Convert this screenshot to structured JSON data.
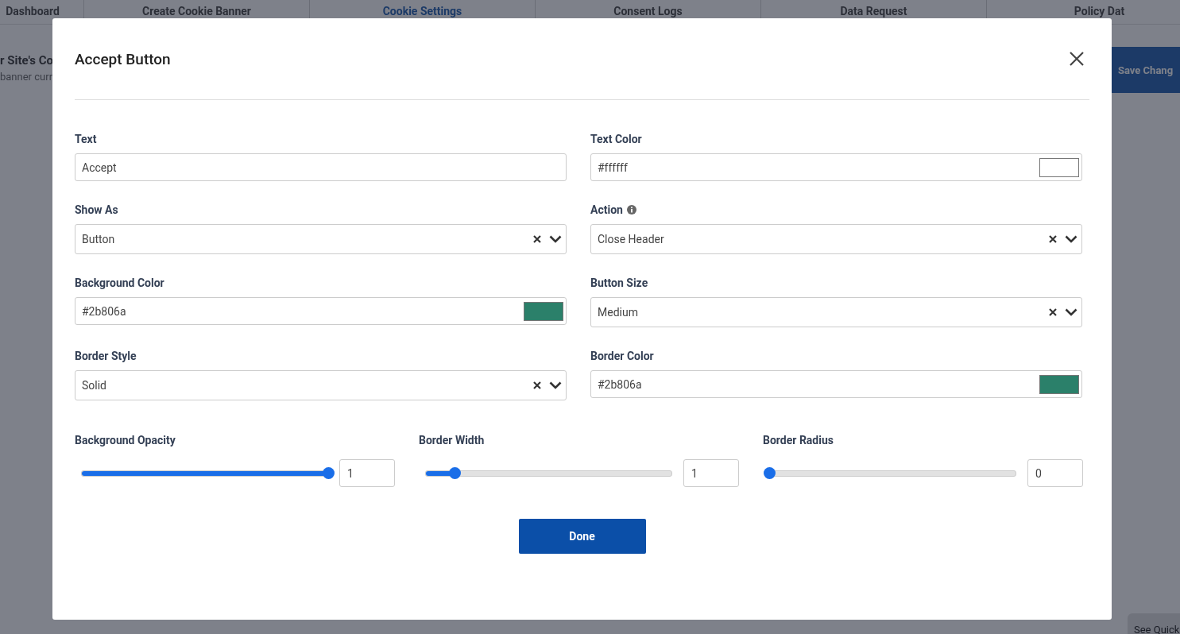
{
  "nav": {
    "tabs": [
      {
        "label": "Dashboard",
        "selected": false
      },
      {
        "label": "Create Cookie Banner",
        "selected": false
      },
      {
        "label": "Cookie Settings",
        "selected": true
      },
      {
        "label": "Consent Logs",
        "selected": false
      },
      {
        "label": "Data Request",
        "selected": false
      },
      {
        "label": "Policy Dat",
        "selected": false
      }
    ]
  },
  "page": {
    "heading": "r Site's Co",
    "subtext": "banner curr",
    "save_button": "Save Chang",
    "help_button": "See Quick"
  },
  "modal": {
    "title": "Accept Button",
    "fields": [
      {
        "label": "Text",
        "kind": "text",
        "value": "Accept",
        "info": false
      },
      {
        "label": "Text Color",
        "kind": "color",
        "value": "#ffffff",
        "info": false
      },
      {
        "label": "Show As",
        "kind": "select",
        "value": "Button",
        "info": false
      },
      {
        "label": "Action",
        "kind": "select",
        "value": "Close Header",
        "info": true
      },
      {
        "label": "Background Color",
        "kind": "color",
        "value": "#2b806a",
        "info": false
      },
      {
        "label": "Button Size",
        "kind": "select",
        "value": "Medium",
        "info": false
      },
      {
        "label": "Border Style",
        "kind": "select",
        "value": "Solid",
        "info": false
      },
      {
        "label": "Border Color",
        "kind": "color",
        "value": "#2b806a",
        "info": false
      }
    ],
    "sliders": [
      {
        "label": "Background Opacity",
        "level": 1,
        "value": "1"
      },
      {
        "label": "Border Width",
        "level": 0.12,
        "value": "1"
      },
      {
        "label": "Border Radius",
        "level": 0,
        "value": "0"
      }
    ],
    "done_button": "Done"
  }
}
